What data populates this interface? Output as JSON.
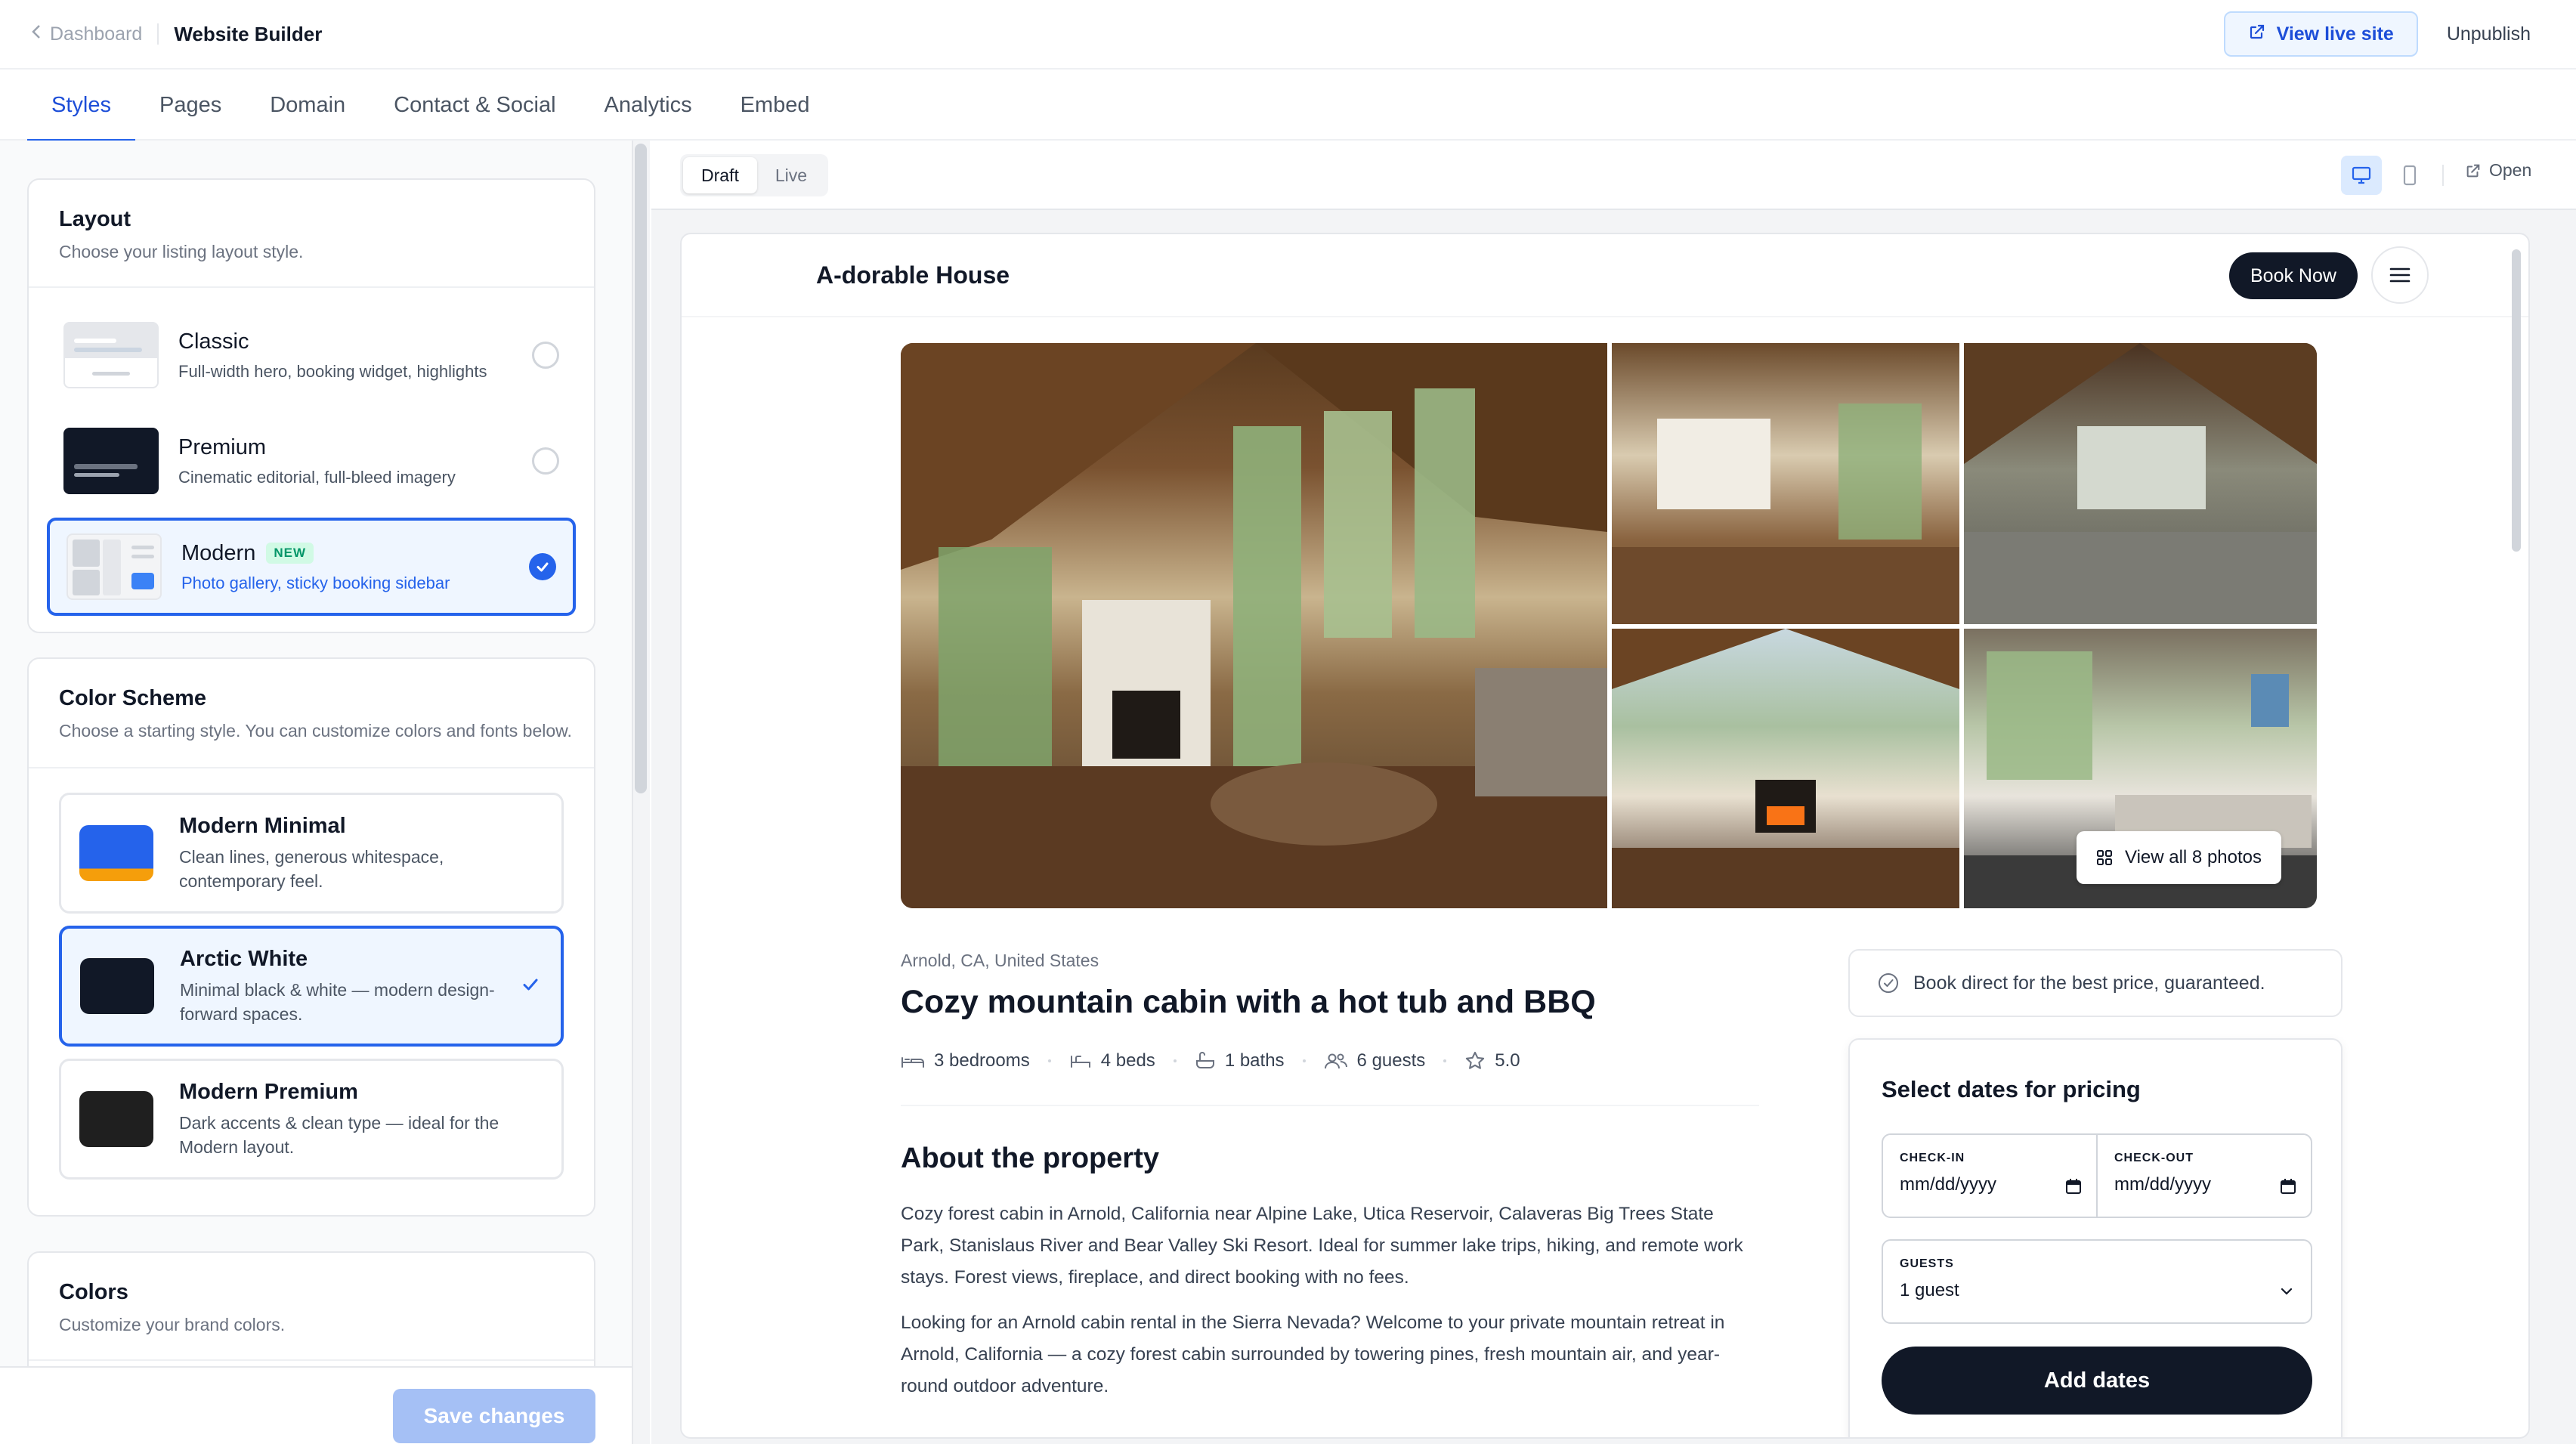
{
  "topbar": {
    "back_label": "Dashboard",
    "title": "Website Builder",
    "view_live_label": "View live site",
    "unpublish_label": "Unpublish"
  },
  "tabs": [
    {
      "label": "Styles",
      "active": true
    },
    {
      "label": "Pages"
    },
    {
      "label": "Domain"
    },
    {
      "label": "Contact & Social"
    },
    {
      "label": "Analytics"
    },
    {
      "label": "Embed"
    }
  ],
  "layout": {
    "title": "Layout",
    "description": "Choose your listing layout style.",
    "options": [
      {
        "name": "Classic",
        "desc": "Full-width hero, booking widget, highlights",
        "selected": false
      },
      {
        "name": "Premium",
        "desc": "Cinematic editorial, full-bleed imagery",
        "selected": false
      },
      {
        "name": "Modern",
        "badge": "NEW",
        "desc": "Photo gallery, sticky booking sidebar",
        "selected": true
      }
    ]
  },
  "color_scheme": {
    "title": "Color Scheme",
    "description": "Choose a starting style. You can customize colors and fonts below.",
    "options": [
      {
        "name": "Modern Minimal",
        "desc": "Clean lines, generous whitespace, contemporary feel.",
        "swatch_top": "#2563eb",
        "swatch_bottom": "#f59e0b",
        "selected": false
      },
      {
        "name": "Arctic White",
        "desc": "Minimal black & white — modern design-forward spaces.",
        "swatch_top": "#111827",
        "swatch_bottom": "#111827",
        "selected": true
      },
      {
        "name": "Modern Premium",
        "desc": "Dark accents & clean type — ideal for the Modern layout.",
        "swatch_top": "#1f1f1f",
        "swatch_bottom": "#1f1f1f",
        "selected": false
      }
    ]
  },
  "colors": {
    "title": "Colors",
    "description": "Customize your brand colors."
  },
  "save_label": "Save changes",
  "preview": {
    "modes": [
      {
        "label": "Draft",
        "active": true
      },
      {
        "label": "Live"
      }
    ],
    "open_label": "Open"
  },
  "site": {
    "name": "A-dorable House",
    "book_label": "Book Now",
    "view_photos_label": "View all 8 photos",
    "location": "Arnold, CA, United States",
    "title": "Cozy mountain cabin with a hot tub and BBQ",
    "facts": {
      "bedrooms": "3 bedrooms",
      "beds": "4 beds",
      "baths": "1 baths",
      "guests": "6 guests",
      "rating": "5.0"
    },
    "about_title": "About the property",
    "about_p1": "Cozy forest cabin in Arnold, California near Alpine Lake, Utica Reservoir, Calaveras Big Trees State Park, Stanislaus River and Bear Valley Ski Resort. Ideal for summer lake trips, hiking, and remote work stays. Forest views, fireplace, and direct booking with no fees.",
    "about_p2": "Looking for an Arnold cabin rental in the Sierra Nevada? Welcome to your private mountain retreat in Arnold, California — a cozy forest cabin surrounded by towering pines, fresh mountain air, and year-round outdoor adventure.",
    "guarantee": "Book direct for the best price, guaranteed.",
    "booking": {
      "title": "Select dates for pricing",
      "checkin_label": "CHECK-IN",
      "checkin_value": "mm/dd/yyyy",
      "checkout_label": "CHECK-OUT",
      "checkout_value": "mm/dd/yyyy",
      "guests_label": "GUESTS",
      "guests_value": "1 guest",
      "add_dates_label": "Add dates"
    }
  }
}
